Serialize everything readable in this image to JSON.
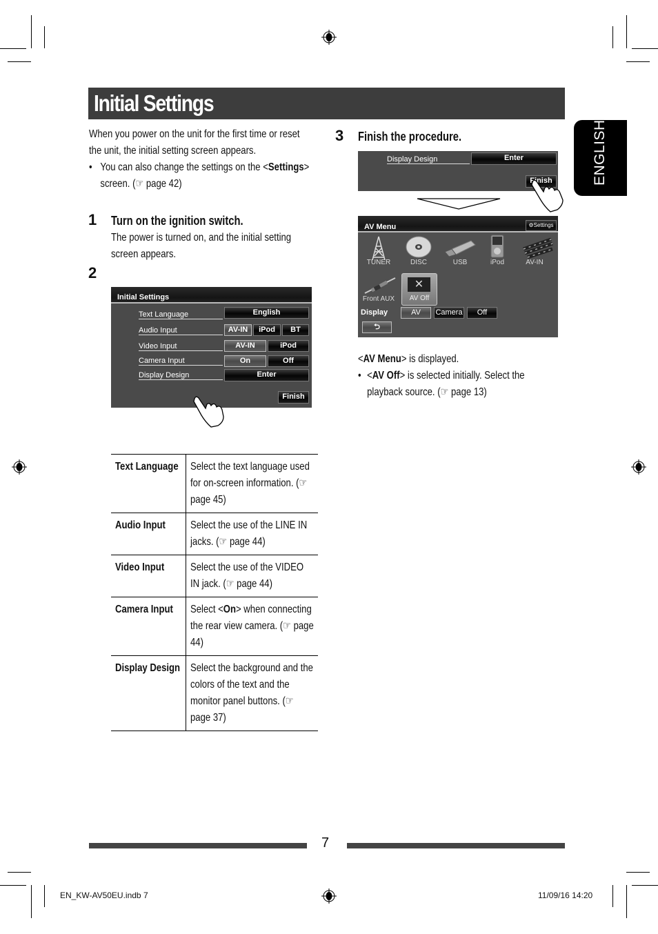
{
  "page": {
    "title": "Initial Settings",
    "language_tab": "ENGLISH",
    "page_number": "7",
    "footer_file": "EN_KW-AV50EU.indb   7",
    "footer_datetime": "11/09/16   14:20"
  },
  "intro": {
    "line1": "When you power on the unit for the first time or reset",
    "line2": "the unit, the initial setting screen appears.",
    "bullet_line1_pre": "You can also change the settings on the <",
    "bullet_line1_bold": "Settings",
    "bullet_line1_post": ">",
    "bullet_line2": "screen. (☞ page 42)"
  },
  "steps": [
    {
      "number": "1",
      "title": "Turn on the ignition switch.",
      "line1": "The power is turned on, and the initial setting",
      "line2": "screen appears."
    },
    {
      "number": "2"
    },
    {
      "number": "3",
      "title": "Finish the procedure."
    }
  ],
  "initial_settings_screen": {
    "header": "Initial Settings",
    "rows": [
      {
        "label": "Text Language",
        "buttons": [
          "English"
        ]
      },
      {
        "label": "Audio Input",
        "buttons": [
          "AV-IN",
          "iPod",
          "BT"
        ]
      },
      {
        "label": "Video Input",
        "buttons": [
          "AV-IN",
          "iPod"
        ]
      },
      {
        "label": "Camera Input",
        "buttons": [
          "On",
          "Off"
        ]
      },
      {
        "label": "Display Design",
        "buttons": [
          "Enter"
        ]
      }
    ],
    "finish": "Finish"
  },
  "finish_screen": {
    "label": "Display Design",
    "enter": "Enter",
    "finish": "Finish"
  },
  "av_menu_screen": {
    "header": "AV Menu",
    "settings": "Settings",
    "sources": [
      "TUNER",
      "DISC",
      "USB",
      "iPod",
      "AV-IN",
      "Front AUX",
      "AV Off"
    ],
    "display_label": "Display",
    "display_buttons": [
      "AV",
      "Camera",
      "Off"
    ],
    "back_icon": "return-arrow"
  },
  "result": {
    "line1_pre": "<",
    "line1_bold": "AV Menu",
    "line1_post": "> is displayed.",
    "bullet_pre": "<",
    "bullet_bold": "AV Off",
    "bullet_post": "> is selected initially. Select the",
    "bullet_line2": "playback source. (☞  page 13)"
  },
  "table": [
    {
      "key": "Text Language",
      "desc": "Select the text language used for on-screen information. (☞  page 45)"
    },
    {
      "key": "Audio Input",
      "desc": "Select the use of the LINE IN jacks. (☞ page 44)"
    },
    {
      "key": "Video Input",
      "desc": "Select the use of the VIDEO IN jack. (☞ page 44)"
    },
    {
      "key": "Camera Input",
      "desc_pre": "Select <",
      "desc_bold": "On",
      "desc_post": "> when connecting the rear view camera. (☞ page 44)"
    },
    {
      "key": "Display Design",
      "desc": "Select the background and the colors of the text and the monitor panel buttons. (☞ page 37)"
    }
  ]
}
